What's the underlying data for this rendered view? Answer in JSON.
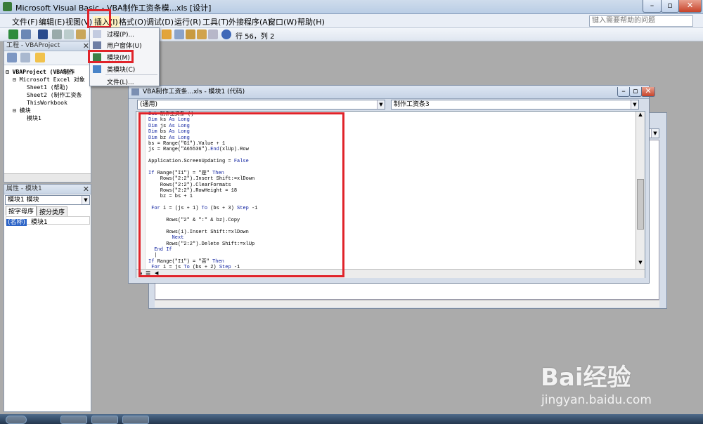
{
  "window": {
    "title": "Microsoft Visual Basic - VBA制作工资条模...xls [设计]"
  },
  "menubar": {
    "items": [
      "文件(F)",
      "编辑(E)",
      "视图(V)",
      "插入(I)",
      "格式(O)",
      "调试(D)",
      "运行(R)",
      "工具(T)",
      "外接程序(A)",
      "窗口(W)",
      "帮助(H)"
    ],
    "help_placeholder": "键入需要帮助的问题"
  },
  "toolbar": {
    "cursor_position": "行 56，列 2"
  },
  "insert_menu": {
    "items": [
      "过程(P)...",
      "用户窗体(U)",
      "模块(M)",
      "类模块(C)",
      "文件(L)..."
    ]
  },
  "project_panel": {
    "title": "工程 - VBAProject",
    "tree": [
      "VBAProject (VBA制作",
      "Microsoft Excel 对象",
      "Sheet1 (帮助)",
      "Sheet2 (制作工资条",
      "ThisWorkbook",
      "模块",
      "模块1"
    ]
  },
  "properties_panel": {
    "title": "属性 - 模块1",
    "object": "模块1 模块",
    "tabs": [
      "按字母序",
      "按分类序"
    ],
    "prop_name": "(名称)",
    "prop_value": "模块1"
  },
  "code_window": {
    "title": "VBA制作工资条...xls - 模块1 (代码)",
    "object_combo": "(通用)",
    "proc_combo": "制作工资条3",
    "lines": [
      "Sub 制作工资条 ()",
      "Dim ks As Long",
      "Dim js As Long",
      "Dim bs As Long",
      "Dim bz As Long",
      "bs = Range(\"G1\").Value + 1",
      "js = Range(\"A65536\").End(xlUp).Row",
      "",
      "Application.ScreenUpdating = False",
      "",
      "If Range(\"I1\") = \"是\" Then",
      "    Rows(\"2:2\").Insert Shift:=xlDown",
      "    Rows(\"2:2\").ClearFormats",
      "    Rows(\"2:2\").RowHeight = 18",
      "    bz = bs + 1",
      "",
      " For i = (js + 1) To (bs + 3) Step -1",
      "",
      "      Rows(\"2\" & \":\" & bz).Copy",
      "",
      "      Rows(i).Insert Shift:=xlDown",
      "        Next",
      "      Rows(\"2:2\").Delete Shift:=xlUp",
      "  End If",
      "  |",
      "If Range(\"I1\") = \"否\" Then",
      " For i = js To (bs + 2) Step -1"
    ]
  },
  "watermark": {
    "brand": "Bai经验",
    "url": "jingyan.baidu.com"
  }
}
